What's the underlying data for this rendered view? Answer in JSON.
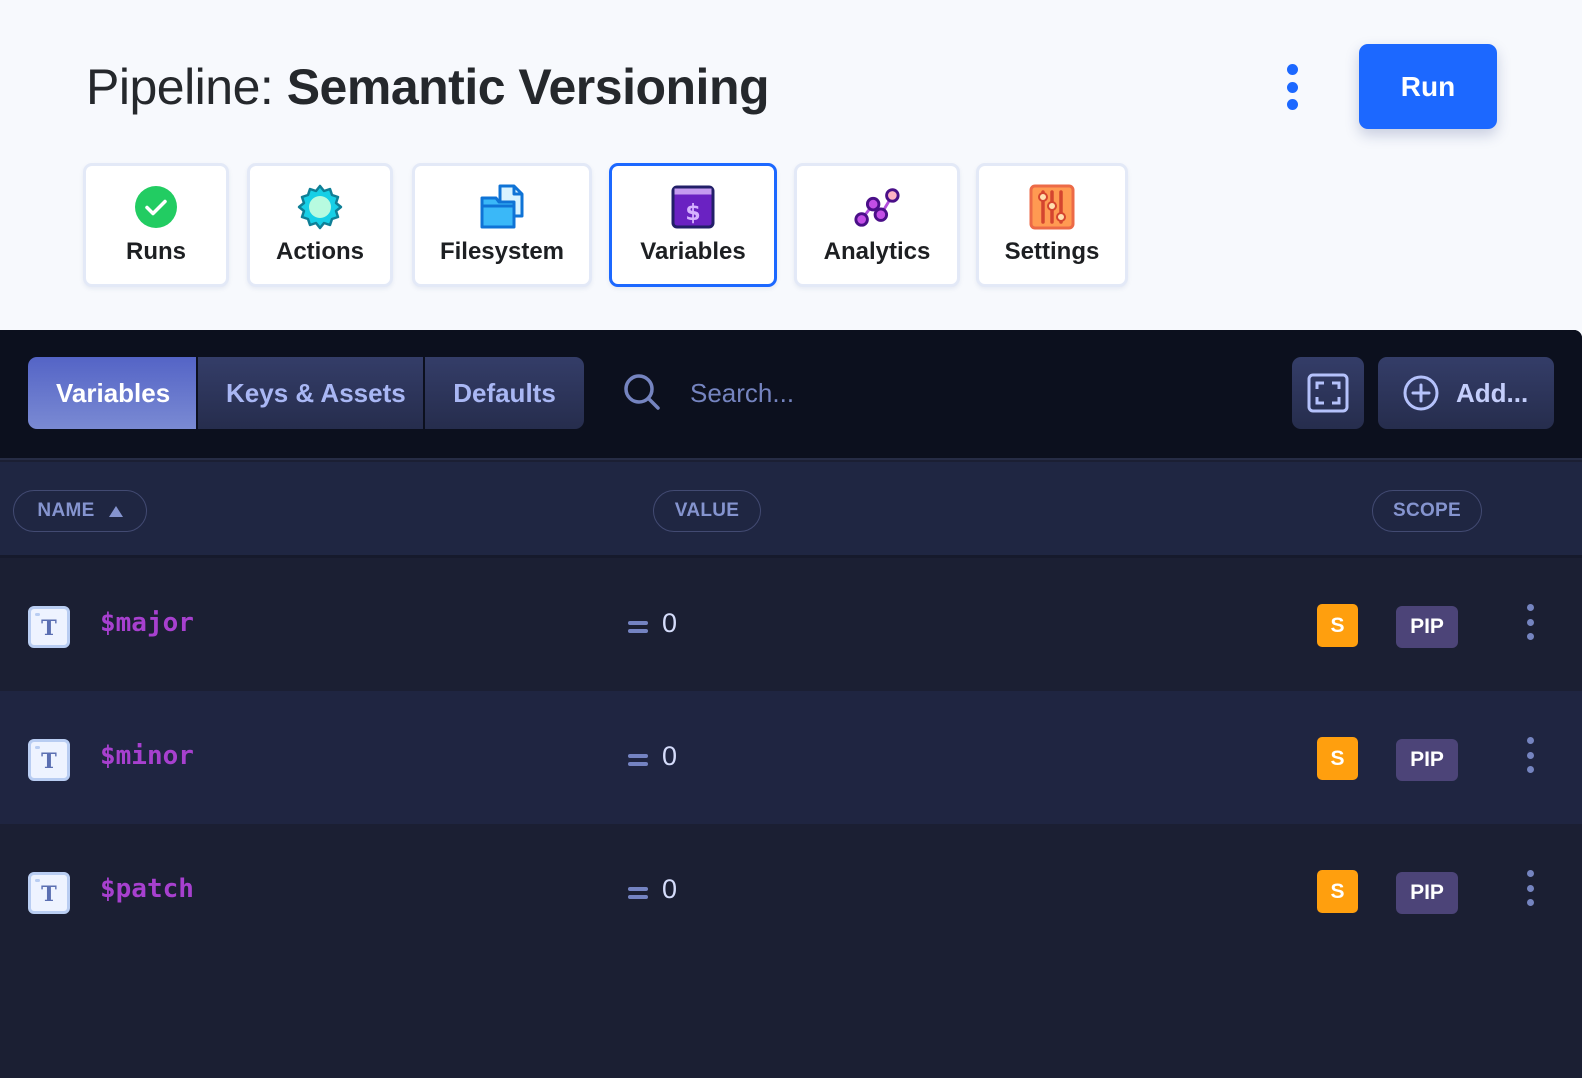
{
  "header": {
    "title_prefix": "Pipeline:",
    "title_name": "Semantic Versioning",
    "more_icon": "kebab-vertical-icon",
    "run_label": "Run",
    "accent_color": "#1c68ff"
  },
  "nav": [
    {
      "label": "Runs",
      "icon": "check-circle-icon",
      "active": false
    },
    {
      "label": "Actions",
      "icon": "gear-icon",
      "active": false
    },
    {
      "label": "Filesystem",
      "icon": "folder-file-icon",
      "active": false
    },
    {
      "label": "Variables",
      "icon": "dollar-window-icon",
      "active": true
    },
    {
      "label": "Analytics",
      "icon": "line-chart-nodes-icon",
      "active": false
    },
    {
      "label": "Settings",
      "icon": "sliders-icon",
      "active": false
    }
  ],
  "toolbar": {
    "tabs": [
      {
        "label": "Variables",
        "active": true
      },
      {
        "label": "Keys & Assets",
        "active": false
      },
      {
        "label": "Defaults",
        "active": false
      }
    ],
    "search": {
      "placeholder": "Search...",
      "value": ""
    },
    "fullscreen_icon": "fullscreen-icon",
    "add_label": "Add..."
  },
  "table": {
    "columns": [
      {
        "label": "NAME",
        "sort": "ascending"
      },
      {
        "label": "VALUE"
      },
      {
        "label": "SCOPE"
      }
    ],
    "rows": [
      {
        "type_icon": "T",
        "name": "$major",
        "operator": "=",
        "value": "0",
        "secret_badge": "S",
        "scope": "PIP"
      },
      {
        "type_icon": "T",
        "name": "$minor",
        "operator": "=",
        "value": "0",
        "secret_badge": "S",
        "scope": "PIP"
      },
      {
        "type_icon": "T",
        "name": "$patch",
        "operator": "=",
        "value": "0",
        "secret_badge": "S",
        "scope": "PIP"
      }
    ]
  }
}
